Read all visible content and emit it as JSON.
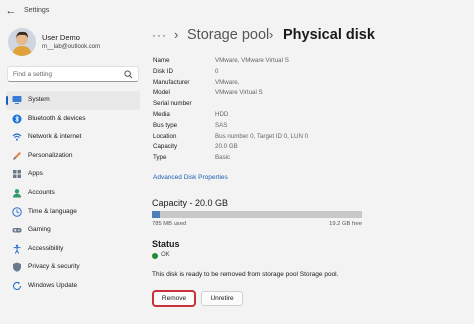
{
  "window": {
    "title": "Settings"
  },
  "profile": {
    "name": "User Demo",
    "email": "m__lab@outlook.com"
  },
  "search": {
    "placeholder": "Find a setting"
  },
  "nav": {
    "items": [
      {
        "label": "System",
        "icon": "system-icon",
        "active": true
      },
      {
        "label": "Bluetooth & devices",
        "icon": "bluetooth-icon"
      },
      {
        "label": "Network & internet",
        "icon": "network-icon"
      },
      {
        "label": "Personalization",
        "icon": "personalization-icon"
      },
      {
        "label": "Apps",
        "icon": "apps-icon"
      },
      {
        "label": "Accounts",
        "icon": "accounts-icon"
      },
      {
        "label": "Time & language",
        "icon": "time-language-icon"
      },
      {
        "label": "Gaming",
        "icon": "gaming-icon"
      },
      {
        "label": "Accessibility",
        "icon": "accessibility-icon"
      },
      {
        "label": "Privacy & security",
        "icon": "privacy-icon"
      },
      {
        "label": "Windows Update",
        "icon": "windows-update-icon"
      }
    ]
  },
  "breadcrumb": {
    "more": "···",
    "parent": "Storage pool",
    "current": "Physical disk"
  },
  "properties": [
    {
      "key": "Name",
      "value": "VMware, VMware Virtual S"
    },
    {
      "key": "Disk ID",
      "value": "0"
    },
    {
      "key": "Manufacturer",
      "value": "VMware,"
    },
    {
      "key": "Model",
      "value": "VMware Virtual S"
    },
    {
      "key": "Serial number",
      "value": ""
    },
    {
      "key": "Media",
      "value": "HDD"
    },
    {
      "key": "Bus type",
      "value": "SAS"
    },
    {
      "key": "Location",
      "value": "Bus number 0, Target ID 0, LUN 0"
    },
    {
      "key": "Capacity",
      "value": "20.0 GB"
    },
    {
      "key": "Type",
      "value": "Basic"
    }
  ],
  "advanced_link": "Advanced Disk Properties",
  "capacity": {
    "title": "Capacity - 20.0 GB",
    "used_label": "785 MB used",
    "free_label": "19.2 GB free",
    "used_fraction": 0.038
  },
  "status": {
    "title": "Status",
    "state": "OK",
    "message": "This disk is ready to be removed from storage pool Storage pool."
  },
  "buttons": {
    "remove": "Remove",
    "unretire": "Unretire"
  },
  "colors": {
    "accent": "#1a5fb4",
    "ok": "#1e8a3c",
    "highlight": "#c8323a"
  }
}
